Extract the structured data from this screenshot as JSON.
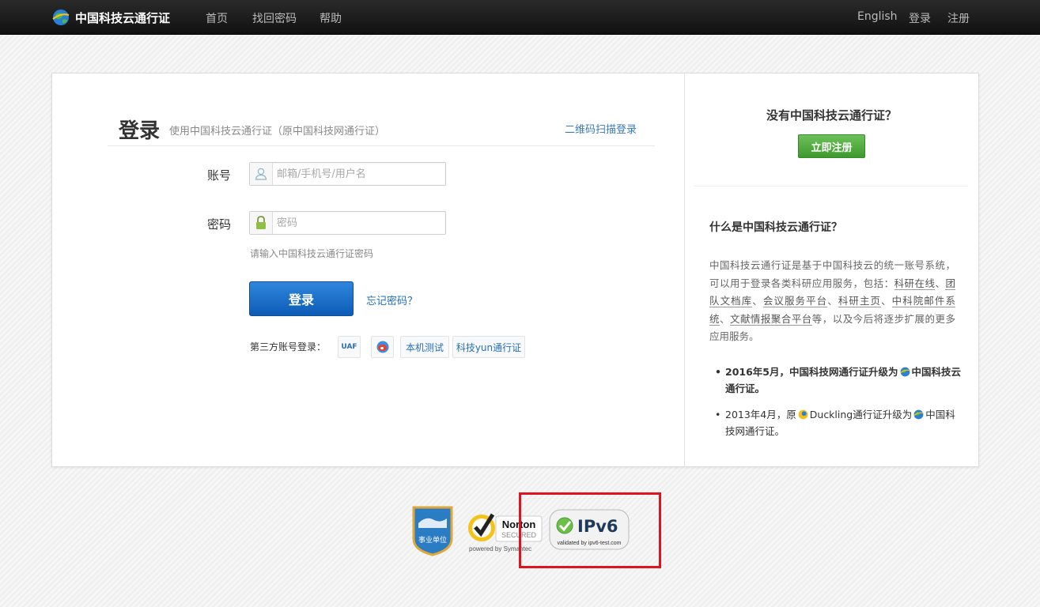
{
  "header": {
    "brand": "中国科技云通行证",
    "nav": [
      "首页",
      "找回密码",
      "帮助"
    ],
    "right_nav": [
      "English",
      "登录",
      "注册"
    ]
  },
  "login": {
    "title": "登录",
    "subtitle": "使用中国科技云通行证（原中国科技网通行证）",
    "qr_link": "二维码扫描登录",
    "account_label": "账号",
    "account_placeholder": "邮箱/手机号/用户名",
    "password_label": "密码",
    "password_placeholder": "密码",
    "password_hint": "请输入中国科技云通行证密码",
    "submit": "登录",
    "forgot": "忘记密码？",
    "third_party_label": "第三方账号登录：",
    "third_party": [
      "UAF",
      "本机测试",
      "科技yun通行证"
    ]
  },
  "sidebar": {
    "no_account": "没有中国科技云通行证？",
    "register": "立即注册",
    "what_title": "什么是中国科技云通行证？",
    "desc_pre": "中国科技云通行证是基于中国科技云的统一账号系统，可以用于登录各类科研应用服务，包括：",
    "services": [
      "科研在线",
      "团队文档库",
      "会议服务平台",
      "科研主页",
      "中科院邮件系统",
      "文献情报聚合平台"
    ],
    "desc_post": "等，以及今后将逐步扩展的更多应用服务。",
    "news1_pre": "2016年5月，中国科技网通行证升级为",
    "news1_post": "中国科技云通行证。",
    "news2_a": "2013年4月，原",
    "news2_b": "Duckling通行证升级为",
    "news2_c": "中国科技网通行证。"
  },
  "badges": {
    "unit": "事业单位",
    "norton_top": "Norton",
    "norton_bottom": "SECURED",
    "norton_powered": "powered by Symantec",
    "ipv6": "IPv6",
    "ipv6_sub": "validated by ipv6-test.com"
  },
  "colors": {
    "link": "#3a7ab8",
    "primary_button": "#1a6bc8",
    "register_button": "#4caa3a",
    "highlight_box": "#e0141e"
  }
}
